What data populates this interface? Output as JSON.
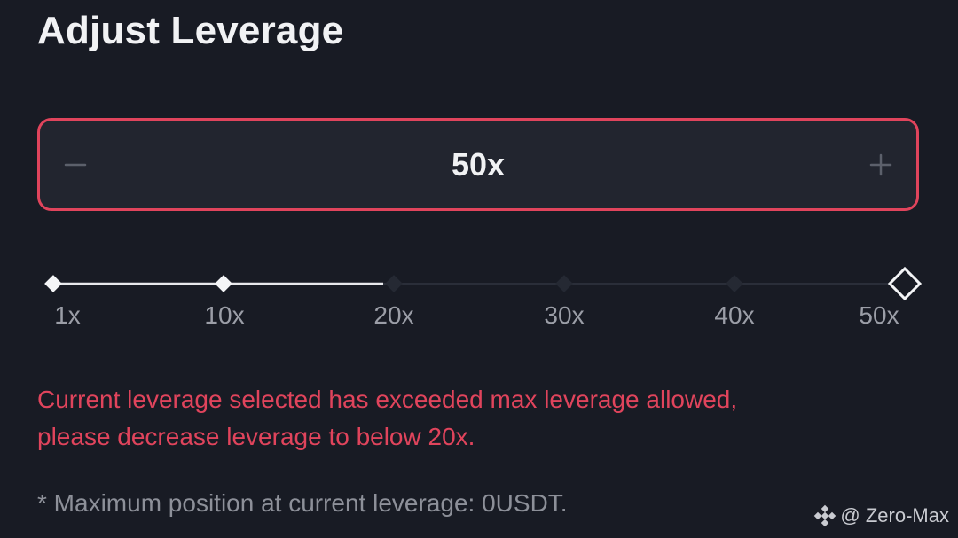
{
  "title": "Adjust Leverage",
  "stepper": {
    "value": "50x",
    "decrease_icon": "minus-icon",
    "increase_icon": "plus-icon"
  },
  "slider": {
    "ticks": [
      "1x",
      "10x",
      "20x",
      "30x",
      "40x",
      "50x"
    ],
    "selected": "50x",
    "max_allowed": "20x"
  },
  "warning": {
    "line1": "Current leverage selected has exceeded max leverage allowed,",
    "line2": "please decrease leverage to below 20x."
  },
  "note": "* Maximum position at current leverage: 0USDT.",
  "watermark": {
    "icon": "binance-logo-icon",
    "text": "@ Zero-Max"
  },
  "colors": {
    "background": "#181b24",
    "alert": "#e0445c",
    "text_primary": "#f1f2f4",
    "text_muted": "#9b9ea7"
  }
}
